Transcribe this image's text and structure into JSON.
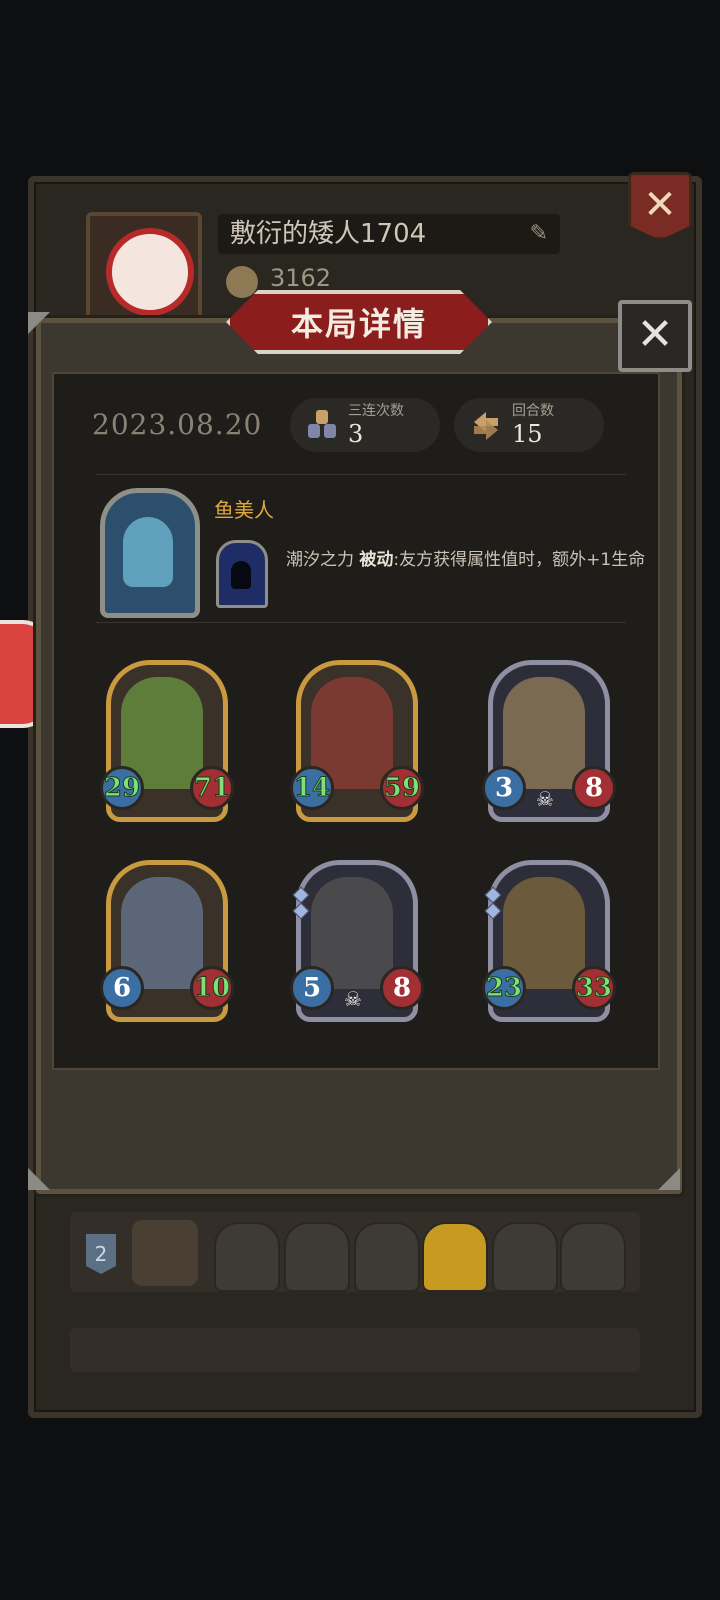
{
  "background_profile": {
    "player_name": "敷衍的矮人1704",
    "coins": "3162",
    "rows": [
      {
        "rank": "2"
      }
    ]
  },
  "modal": {
    "title": "本局详情",
    "close_label": "✕",
    "date": "2023.08.20",
    "stats": [
      {
        "label": "三连次数",
        "value": "3",
        "icon": "triple-icon"
      },
      {
        "label": "回合数",
        "value": "15",
        "icon": "rounds-icon"
      }
    ],
    "hero": {
      "name": "鱼美人",
      "skill_name": "潮汐之力",
      "skill_type": "被动",
      "skill_desc": ":友方获得属性值时，额外+1生命"
    },
    "units": [
      {
        "attack": "29",
        "health": "71",
        "frame": "gold",
        "attack_buffed": true,
        "health_buffed": true,
        "skull": false
      },
      {
        "attack": "14",
        "health": "59",
        "frame": "gold",
        "attack_buffed": true,
        "health_buffed": true,
        "skull": false
      },
      {
        "attack": "3",
        "health": "8",
        "frame": "silver",
        "attack_buffed": false,
        "health_buffed": false,
        "skull": true
      },
      {
        "attack": "6",
        "health": "10",
        "frame": "gold",
        "attack_buffed": false,
        "health_buffed": true,
        "skull": false
      },
      {
        "attack": "5",
        "health": "8",
        "frame": "silver",
        "attack_buffed": false,
        "health_buffed": false,
        "skull": true
      },
      {
        "attack": "23",
        "health": "33",
        "frame": "silver",
        "attack_buffed": true,
        "health_buffed": true,
        "skull": false
      }
    ]
  },
  "colors": {
    "title_banner": "#8c1d1d",
    "hero_name": "#e1a83b",
    "buff_number": "#7fe07a",
    "attack_orb": "#3b6ea2",
    "health_orb": "#a12f34"
  }
}
